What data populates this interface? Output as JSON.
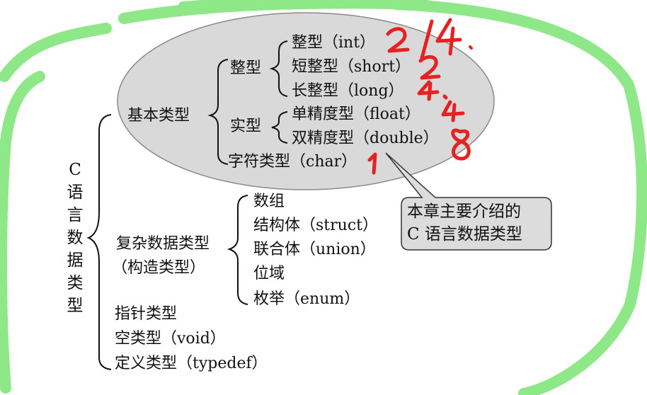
{
  "root": {
    "chars": [
      "C",
      "语",
      "言",
      "数",
      "据",
      "类",
      "型"
    ]
  },
  "basic": {
    "label": "基本类型",
    "integer": {
      "label": "整型",
      "items": [
        "整型（int）",
        "短整型（short）",
        "长整型（long）"
      ]
    },
    "real": {
      "label": "实型",
      "items": [
        "单精度型（float）",
        "双精度型（double）"
      ]
    },
    "char": "字符类型（char）"
  },
  "complex": {
    "label_line1": "复杂数据类型",
    "label_line2": "（构造类型）",
    "items": [
      "数组",
      "结构体（struct）",
      "联合体（union）",
      "位域",
      "枚举（enum）"
    ]
  },
  "others": [
    "指针类型",
    "空类型（void）",
    "定义类型（typedef）"
  ],
  "callout": {
    "line1": "本章主要介绍的",
    "line2": "C 语言数据类型"
  },
  "handwriting": {
    "note": "2/4.  2  4.4  8  1",
    "color": "#e8201f"
  },
  "colors": {
    "ellipse_fill": "#d9d9d9",
    "callout_fill": "#dcdcdc",
    "green_stroke": "#8ee887",
    "ink": "#111111"
  }
}
